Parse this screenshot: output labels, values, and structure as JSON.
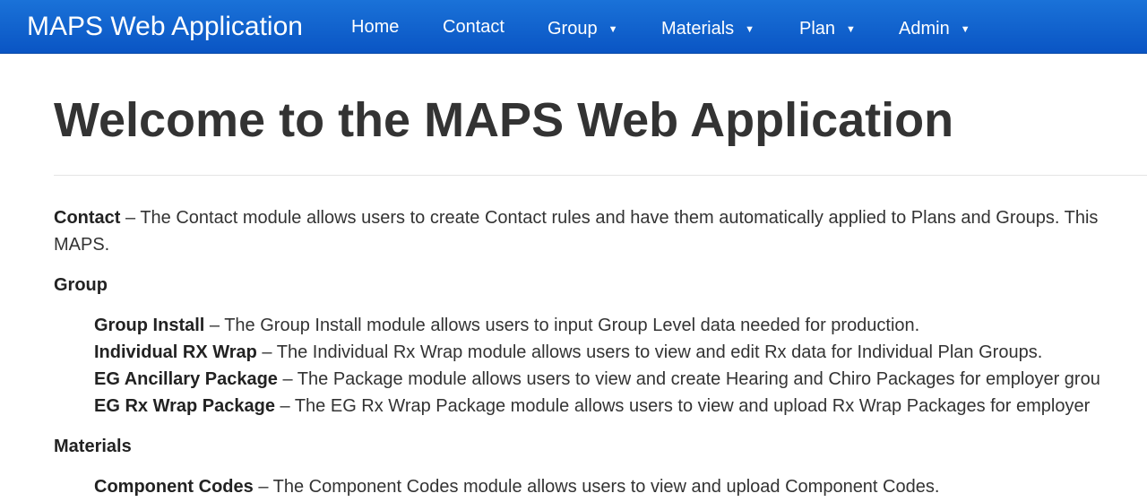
{
  "navbar": {
    "brand": "MAPS Web Application",
    "items": [
      {
        "label": "Home",
        "dropdown": false
      },
      {
        "label": "Contact",
        "dropdown": false
      },
      {
        "label": "Group",
        "dropdown": true
      },
      {
        "label": "Materials",
        "dropdown": true
      },
      {
        "label": "Plan",
        "dropdown": true
      },
      {
        "label": "Admin",
        "dropdown": true
      }
    ],
    "caret": "▼",
    "colors": {
      "bar": "#0a55c4",
      "text": "#ffffff"
    }
  },
  "main": {
    "title": "Welcome to the MAPS Web Application",
    "contact": {
      "term": "Contact",
      "desc_line1": " – The Contact module allows users to create Contact rules and have them automatically applied to Plans and Groups. This",
      "desc_line2": "MAPS."
    },
    "group": {
      "heading": "Group",
      "items": [
        {
          "term": "Group Install",
          "desc": " – The Group Install module allows users to input Group Level data needed for production."
        },
        {
          "term": "Individual RX Wrap",
          "desc": " – The Individual Rx Wrap module allows users to view and edit Rx data for Individual Plan Groups."
        },
        {
          "term": "EG Ancillary Package",
          "desc": " – The Package module allows users to view and create Hearing and Chiro Packages for employer grou"
        },
        {
          "term": "EG Rx Wrap Package",
          "desc": " – The EG Rx Wrap Package module allows users to view and upload Rx Wrap Packages for employer"
        }
      ]
    },
    "materials": {
      "heading": "Materials",
      "items": [
        {
          "term": "Component Codes",
          "desc": " – The Component Codes module allows users to view and upload Component Codes."
        }
      ]
    }
  }
}
